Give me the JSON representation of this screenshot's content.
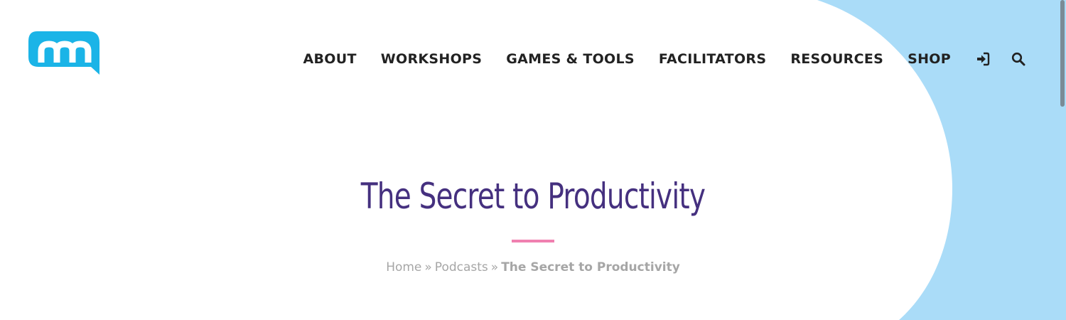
{
  "brand": {
    "logo_icon": "m-speech-bubble-logo",
    "logo_color": "#1bb4e7"
  },
  "nav": {
    "items": [
      {
        "label": "ABOUT"
      },
      {
        "label": "WORKSHOPS"
      },
      {
        "label": "GAMES & TOOLS"
      },
      {
        "label": "FACILITATORS"
      },
      {
        "label": "RESOURCES"
      },
      {
        "label": "SHOP"
      }
    ],
    "login_icon": "sign-in-icon",
    "search_icon": "search-icon"
  },
  "page": {
    "title": "The Secret to Productivity",
    "title_color": "#45307f",
    "divider_color": "#f080b0",
    "background_shape_color": "#aadcf8"
  },
  "breadcrumb": {
    "items": [
      {
        "label": "Home"
      },
      {
        "label": "Podcasts"
      },
      {
        "label": "The Secret to Productivity"
      }
    ],
    "separator": "»"
  }
}
